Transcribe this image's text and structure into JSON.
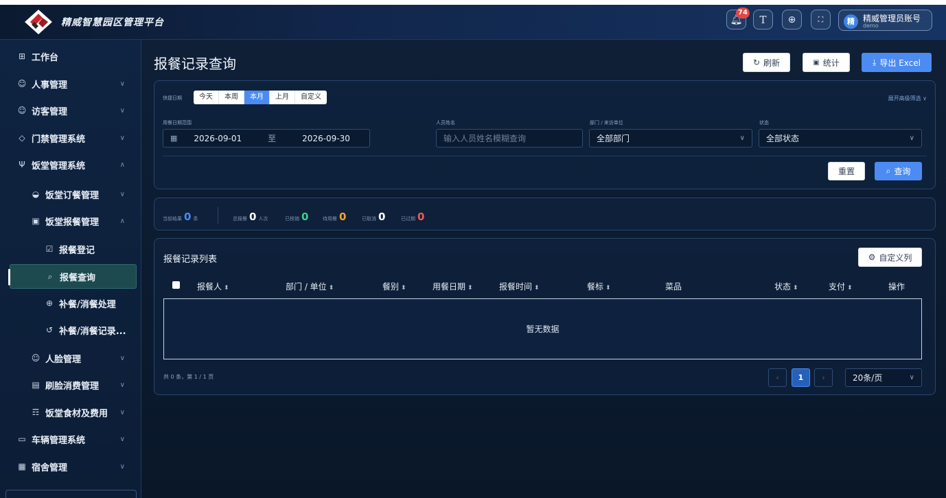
{
  "app": {
    "title": "精威智慧园区管理平台"
  },
  "header": {
    "notif_count": "74",
    "font_btn": "T",
    "user": {
      "avatar": "精",
      "name": "精威管理员账号",
      "sub": "demo"
    }
  },
  "sidebar": {
    "items": [
      {
        "label": "工作台",
        "icon": "grid-icon"
      },
      {
        "label": "人事管理",
        "icon": "users-icon"
      },
      {
        "label": "访客管理",
        "icon": "visitor-icon"
      },
      {
        "label": "门禁管理系统",
        "icon": "shield-icon"
      },
      {
        "label": "饭堂管理系统",
        "icon": "fork-icon"
      },
      {
        "label": "饭堂订餐管理",
        "icon": "cake-icon"
      },
      {
        "label": "饭堂报餐管理",
        "icon": "clipboard-icon"
      },
      {
        "label": "报餐登记",
        "icon": "clipboard-check-icon"
      },
      {
        "label": "报餐查询",
        "icon": "search-icon"
      },
      {
        "label": "补餐/消餐处理",
        "icon": "plus-circle-icon"
      },
      {
        "label": "补餐/消餐记录...",
        "icon": "history-icon"
      },
      {
        "label": "人脸管理",
        "icon": "face-icon"
      },
      {
        "label": "刷脸消费管理",
        "icon": "wallet-icon"
      },
      {
        "label": "饭堂食材及费用",
        "icon": "cart-icon"
      },
      {
        "label": "车辆管理系统",
        "icon": "car-icon"
      },
      {
        "label": "宿舍管理",
        "icon": "building-icon"
      }
    ]
  },
  "page": {
    "title": "报餐记录查询",
    "actions": {
      "refresh": "刷新",
      "stats": "统计",
      "export": "导出 Excel"
    }
  },
  "filters": {
    "quick_label": "快捷日期",
    "quick_options": [
      "今天",
      "本周",
      "本月",
      "上月",
      "自定义"
    ],
    "quick_selected": "本月",
    "advanced": "展开高级筛选",
    "date_label": "用餐日期范围",
    "date_start": "2026-09-01",
    "date_sep": "至",
    "date_end": "2026-09-30",
    "name_label": "人员姓名",
    "name_placeholder": "输入人员姓名模糊查询",
    "dept_label": "部门 / 来访单位",
    "dept_value": "全部部门",
    "status_label": "状态",
    "status_value": "全部状态",
    "reset": "重置",
    "query": "查询"
  },
  "stats": {
    "current": {
      "label": "当前结果",
      "value": "0",
      "unit": "条"
    },
    "total": {
      "label": "总报餐",
      "value": "0",
      "unit": "人次"
    },
    "verified": {
      "label": "已核销",
      "value": "0"
    },
    "pending": {
      "label": "待用餐",
      "value": "0"
    },
    "cancelled": {
      "label": "已取消",
      "value": "0"
    },
    "expired": {
      "label": "已过期",
      "value": "0"
    },
    "colors": {
      "current": "#4c8bf2",
      "verified": "#3ecf8e",
      "pending": "#f5a623",
      "expired": "#f05a5a"
    }
  },
  "table": {
    "title": "报餐记录列表",
    "custom_cols": "自定义列",
    "columns": [
      "报餐人",
      "部门 / 单位",
      "餐别",
      "用餐日期",
      "报餐时间",
      "餐标",
      "菜品",
      "状态",
      "支付",
      "操作"
    ],
    "empty_text": "暂无数据"
  },
  "pagination": {
    "summary": "共 0 条，第 1 / 1 页",
    "prev": "‹",
    "current": "1",
    "next": "›",
    "page_size": "20条/页"
  }
}
